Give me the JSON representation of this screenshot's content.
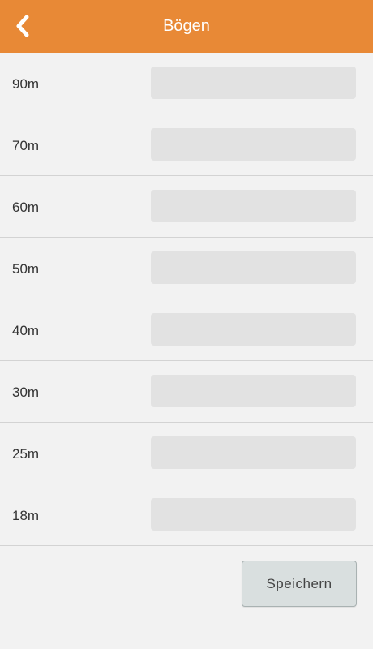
{
  "header": {
    "title": "Bögen",
    "back_icon": "chevron-left-icon",
    "background_color": "#e88936"
  },
  "rows": [
    {
      "label": "90m",
      "value": ""
    },
    {
      "label": "70m",
      "value": ""
    },
    {
      "label": "60m",
      "value": ""
    },
    {
      "label": "50m",
      "value": ""
    },
    {
      "label": "40m",
      "value": ""
    },
    {
      "label": "30m",
      "value": ""
    },
    {
      "label": "25m",
      "value": ""
    },
    {
      "label": "18m",
      "value": ""
    }
  ],
  "actions": {
    "save_label": "Speichern"
  }
}
